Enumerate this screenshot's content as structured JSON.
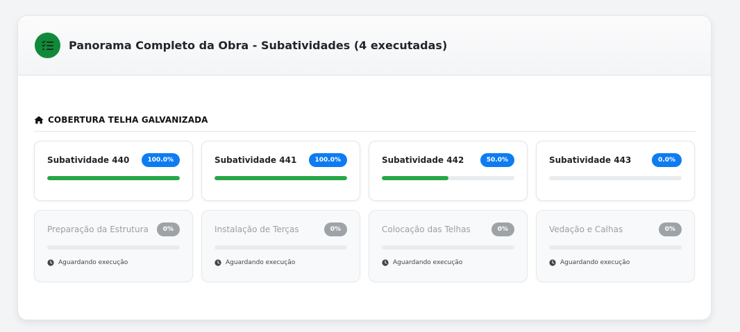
{
  "header": {
    "title": "Panorama Completo da Obra - Subatividades (4 executadas)",
    "icon": "checklist-icon",
    "icon_color": "#0f8a3a"
  },
  "section": {
    "title": "COBERTURA TELHA GALVANIZADA",
    "icon": "home-icon"
  },
  "executed": [
    {
      "name": "Subatividade 440",
      "percent_label": "100.0%",
      "progress": 100
    },
    {
      "name": "Subatividade 441",
      "percent_label": "100.0%",
      "progress": 100
    },
    {
      "name": "Subatividade 442",
      "percent_label": "50.0%",
      "progress": 50
    },
    {
      "name": "Subatividade 443",
      "percent_label": "0.0%",
      "progress": 0
    }
  ],
  "pending": [
    {
      "name": "Preparação da Estrutura",
      "percent_label": "0%",
      "progress": 0,
      "status": "Aguardando execução"
    },
    {
      "name": "Instalação de Terças",
      "percent_label": "0%",
      "progress": 0,
      "status": "Aguardando execução"
    },
    {
      "name": "Colocação das Telhas",
      "percent_label": "0%",
      "progress": 0,
      "status": "Aguardando execução"
    },
    {
      "name": "Vedação e Calhas",
      "percent_label": "0%",
      "progress": 0,
      "status": "Aguardando execução"
    }
  ],
  "colors": {
    "badge_active": "#0d7cf2",
    "badge_pending": "#9ea3a8",
    "progress_fill": "#28a745",
    "progress_track": "#e9ecef"
  }
}
